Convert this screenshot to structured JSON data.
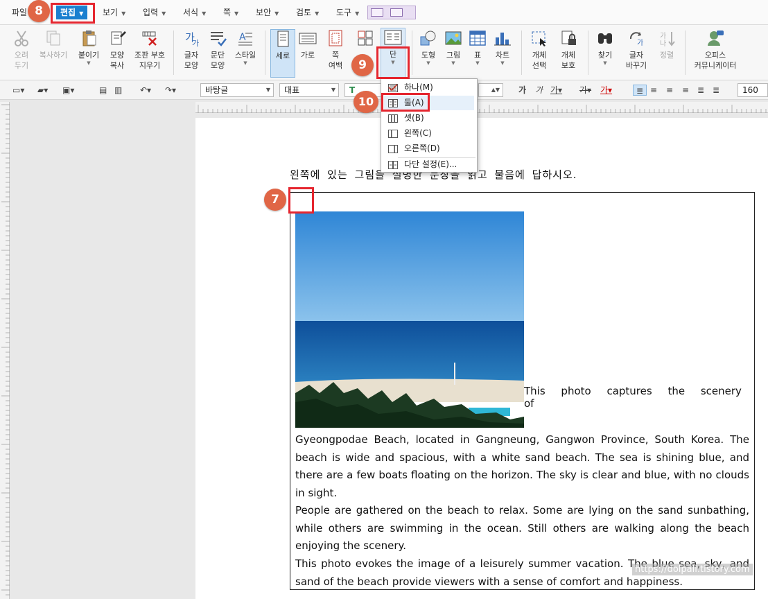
{
  "menu": {
    "file": "파일",
    "edit": "편집",
    "view": "보기",
    "insert": "입력",
    "format": "서식",
    "page": "쪽",
    "security": "보안",
    "review": "검토",
    "tools": "도구"
  },
  "ribbon": {
    "cut": "오려\n두기",
    "copy": "복사하기",
    "paste": "붙이기",
    "format_copy": "모양\n복사",
    "clear_marks": "조판 부호\n지우기",
    "char_shape": "글자\n모양",
    "para_shape": "문단\n모양",
    "style": "스타일",
    "portrait": "세로",
    "landscape": "가로",
    "page_margin": "쪽\n여백",
    "columns": "단",
    "shape": "도형",
    "picture": "그림",
    "table": "표",
    "chart": "차트",
    "obj_select": "개체\n선택",
    "obj_protect": "개체\n보호",
    "find": "찾기",
    "char_replace": "글자\n바꾸기",
    "sort": "정렬",
    "office_communicator": "오피스\n커뮤니케이터"
  },
  "format_toolbar": {
    "style_name": "바탕글",
    "font_lang": "대표",
    "font_size": "160"
  },
  "document": {
    "instruction": "왼쪽에 있는 그림을 설명한 문장을 읽고 물음에 답하시오.",
    "first_line": "This photo captures the scenery of",
    "para1": "Gyeongpodae Beach, located in Gangneung, Gangwon Province, South Korea. The beach is wide and spacious, with a white sand beach. The sea is shining blue, and there are a few boats floating on the horizon. The sky is clear and blue, with no clouds in sight.",
    "para2": "People are gathered on the beach to relax. Some are lying on the sand sunbathing, while others are swimming in the ocean. Still others are walking along the beach enjoying the scenery.",
    "para3": "This photo evokes the image of a leisurely summer vacation. The blue sea, sky, and sand of the beach provide viewers with a sense of comfort and happiness."
  },
  "columns_menu": {
    "one": "하나(M)",
    "two": "둘(A)",
    "three": "셋(B)",
    "left": "왼쪽(C)",
    "right": "오른쪽(D)",
    "settings": "다단 설정(E)..."
  },
  "steps": {
    "s7": "7",
    "s8": "8",
    "s9": "9",
    "s10": "10"
  },
  "watermark": "https://dolpali.tistory.com",
  "colors": {
    "accent": "#1a7fcf",
    "highlight": "#e5262f",
    "step_badge": "#e06646",
    "sea": "#1f72b8"
  }
}
